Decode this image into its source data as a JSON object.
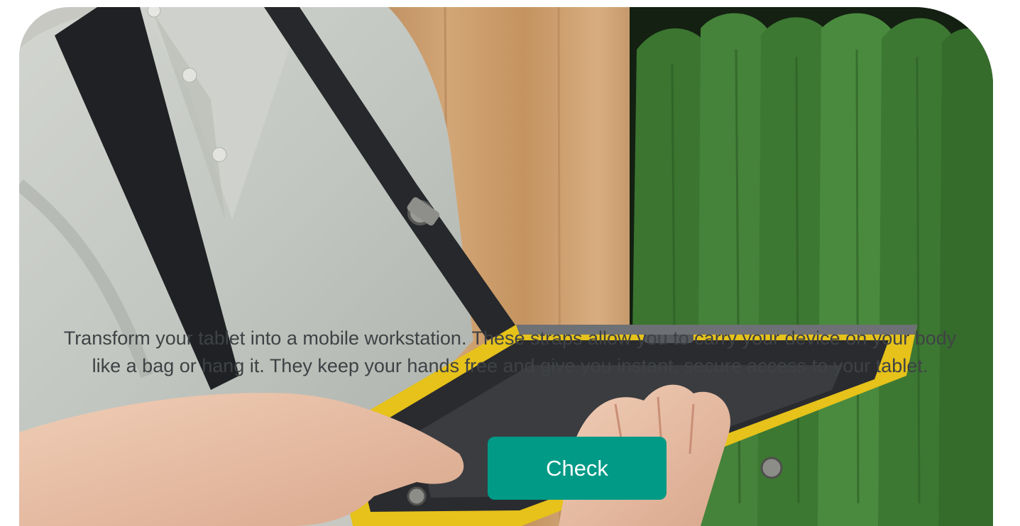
{
  "banner": {
    "photo": {
      "subject": "person in grey polo holding a rugged yellow and black tablet on a shoulder strap",
      "colors": {
        "shirt": "#c9ccc6",
        "wood_wall": "#c99a68",
        "garments": "#3f7a32",
        "strap": "#222428",
        "tablet_frame": "#e6c21a",
        "tablet_body": "#2a2b2e"
      }
    },
    "description_lines": [
      "Transform your tablet into a mobile workstation. These straps allow you to carry your device on your body",
      "like a bag or hang it. They keep your hands free and give you instant, secure access to your tablet."
    ],
    "text_color": "#3f4245",
    "cta": {
      "label": "Check",
      "color": "#009a86",
      "text_color": "#ffffff"
    }
  }
}
